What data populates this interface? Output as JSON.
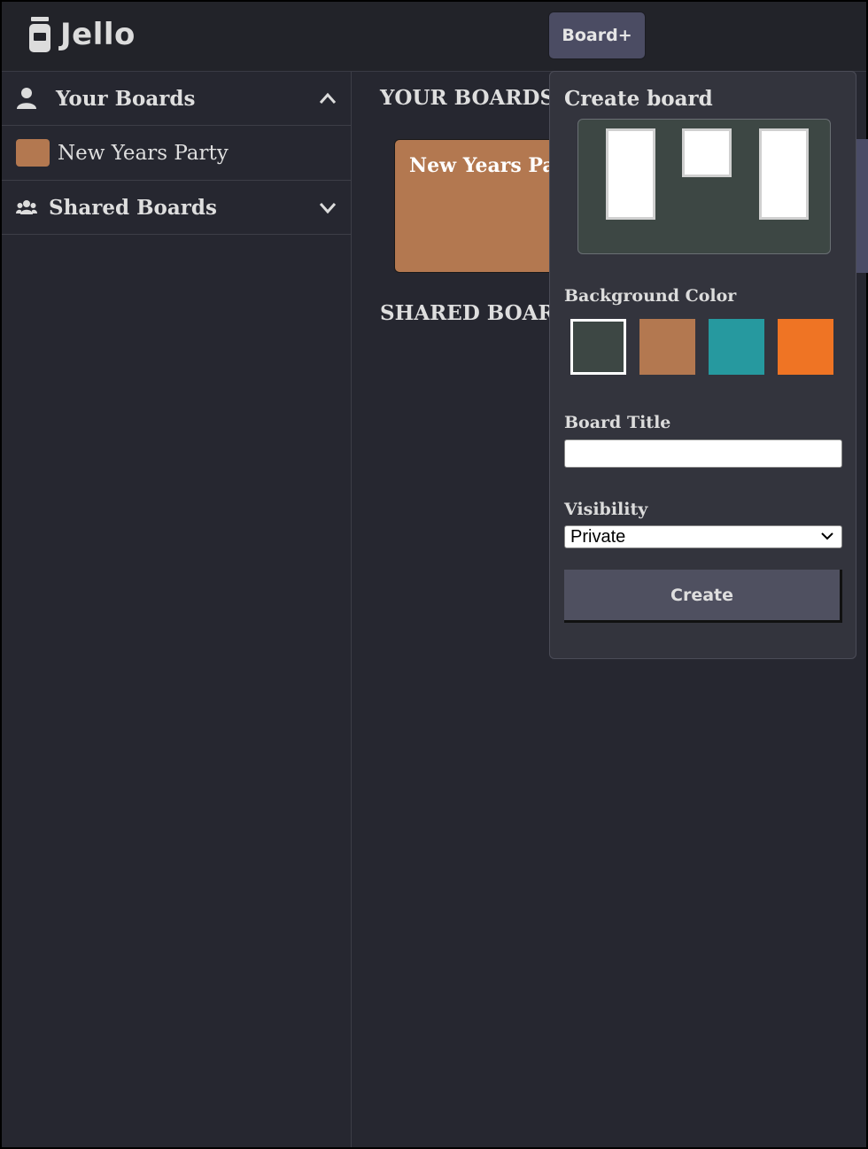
{
  "app": {
    "name": "Jello"
  },
  "header": {
    "board_button_label": "Board+"
  },
  "sidebar": {
    "your_boards": {
      "label": "Your Boards",
      "expanded": true,
      "icon": "user-icon"
    },
    "boards": [
      {
        "label": "New Years Party",
        "color": "#b37850"
      }
    ],
    "shared_boards": {
      "label": "Shared Boards",
      "expanded": false,
      "icon": "users-icon"
    }
  },
  "main": {
    "your_boards_heading": "YOUR BOARDS",
    "shared_boards_heading": "SHARED BOARDS",
    "boards": [
      {
        "title": "New Years Party",
        "color": "#b37850"
      }
    ]
  },
  "create_board": {
    "title": "Create board",
    "background_color_label": "Background Color",
    "colors": [
      "#3d4744",
      "#b37850",
      "#26999f",
      "#ef7424"
    ],
    "selected_color": "#3d4744",
    "board_title_label": "Board Title",
    "board_title_value": "",
    "visibility_label": "Visibility",
    "visibility_value": "Private",
    "create_label": "Create"
  }
}
